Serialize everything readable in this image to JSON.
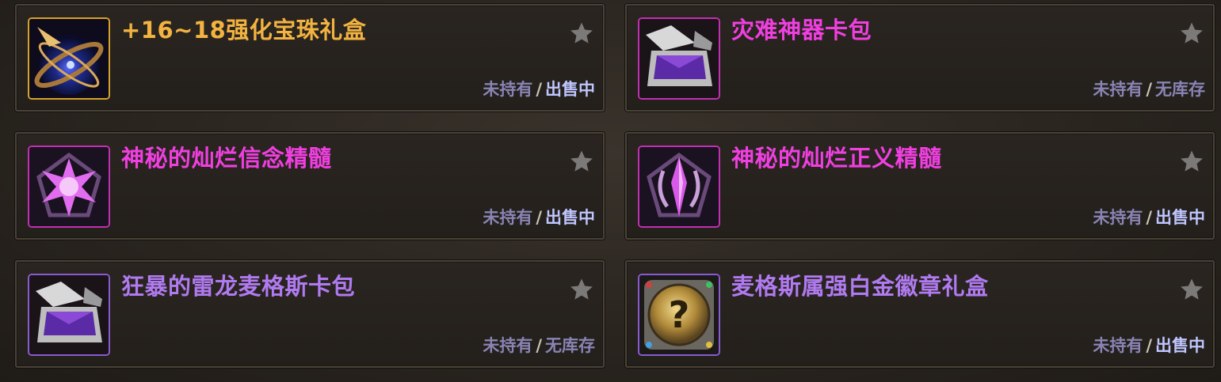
{
  "items": [
    {
      "title": "+16~18强化宝珠礼盒",
      "title_color": "#f3b341",
      "border_color": "#d6a12b",
      "icon": "orb-box-icon",
      "own": "未持有",
      "sep": "/",
      "avail": "出售中",
      "avail_state": "on-sale"
    },
    {
      "title": "灾难神器卡包",
      "title_color": "#f03fe0",
      "border_color": "#c22fb2",
      "icon": "card-pack-icon",
      "own": "未持有",
      "sep": "/",
      "avail": "无库存",
      "avail_state": "out-of-stock"
    },
    {
      "title": "神秘的灿烂信念精髓",
      "title_color": "#f03fe0",
      "border_color": "#c22fb2",
      "icon": "star-essence-icon",
      "own": "未持有",
      "sep": "/",
      "avail": "出售中",
      "avail_state": "on-sale"
    },
    {
      "title": "神秘的灿烂正义精髓",
      "title_color": "#f03fe0",
      "border_color": "#c22fb2",
      "icon": "crystal-essence-icon",
      "own": "未持有",
      "sep": "/",
      "avail": "出售中",
      "avail_state": "on-sale"
    },
    {
      "title": "狂暴的雷龙麦格斯卡包",
      "title_color": "#b07af0",
      "border_color": "#8a5ad0",
      "icon": "card-pack-icon",
      "own": "未持有",
      "sep": "/",
      "avail": "无库存",
      "avail_state": "out-of-stock"
    },
    {
      "title": "麦格斯属强白金徽章礼盒",
      "title_color": "#b07af0",
      "border_color": "#8a5ad0",
      "icon": "mystery-emblem-icon",
      "own": "未持有",
      "sep": "/",
      "avail": "出售中",
      "avail_state": "on-sale"
    }
  ],
  "icons": {
    "favorite": "star-icon"
  }
}
